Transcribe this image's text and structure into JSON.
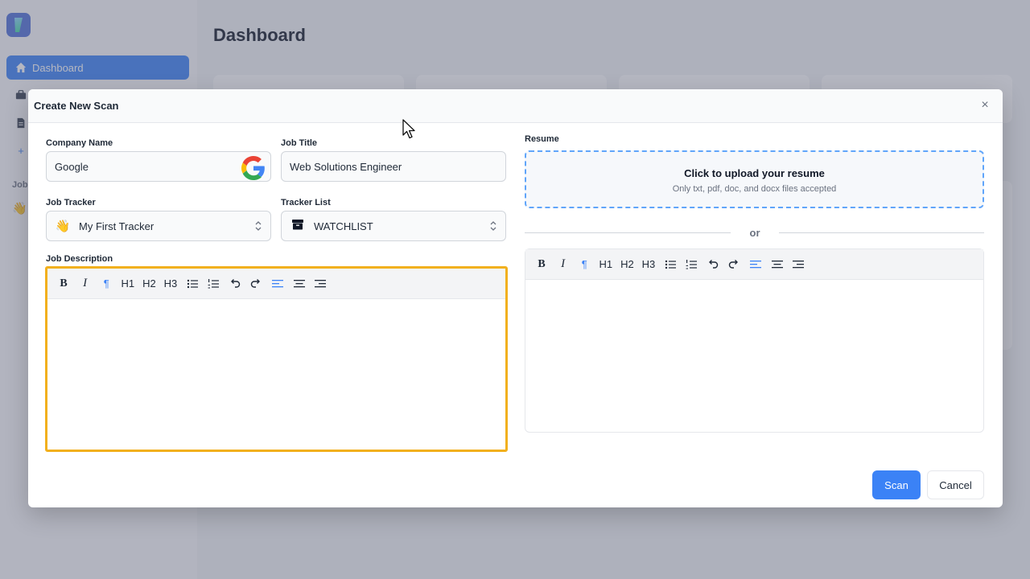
{
  "app": {
    "page_title": "Dashboard",
    "sidebar": {
      "items": [
        {
          "label": "Dashboard",
          "icon": "home-icon",
          "active": true
        },
        {
          "label": "",
          "icon": "briefcase-icon"
        },
        {
          "label": "",
          "icon": "document-icon"
        },
        {
          "label": "",
          "icon": "plus-icon"
        }
      ],
      "section_label": "Job",
      "tracker_icon": "👋"
    }
  },
  "modal": {
    "title": "Create New Scan",
    "close_glyph": "×",
    "company": {
      "label": "Company Name",
      "value": "Google",
      "logo": "google-logo"
    },
    "job_title": {
      "label": "Job Title",
      "value": "Web Solutions Engineer"
    },
    "job_tracker": {
      "label": "Job Tracker",
      "emoji": "👋",
      "value": "My First Tracker"
    },
    "tracker_list": {
      "label": "Tracker List",
      "value": "WATCHLIST",
      "icon": "archive-icon"
    },
    "job_description": {
      "label": "Job Description",
      "content": ""
    },
    "resume": {
      "label": "Resume",
      "upload_title": "Click to upload your resume",
      "upload_sub": "Only txt, pdf, doc, and docx files accepted",
      "or_text": "or",
      "content": ""
    },
    "toolbar": {
      "bold": "B",
      "italic": "I",
      "h1": "H1",
      "h2": "H2",
      "h3": "H3"
    },
    "buttons": {
      "scan": "Scan",
      "cancel": "Cancel"
    }
  },
  "colors": {
    "accent": "#3b82f6",
    "focus_border": "#f2b01e",
    "upload_border": "#60a5fa"
  }
}
